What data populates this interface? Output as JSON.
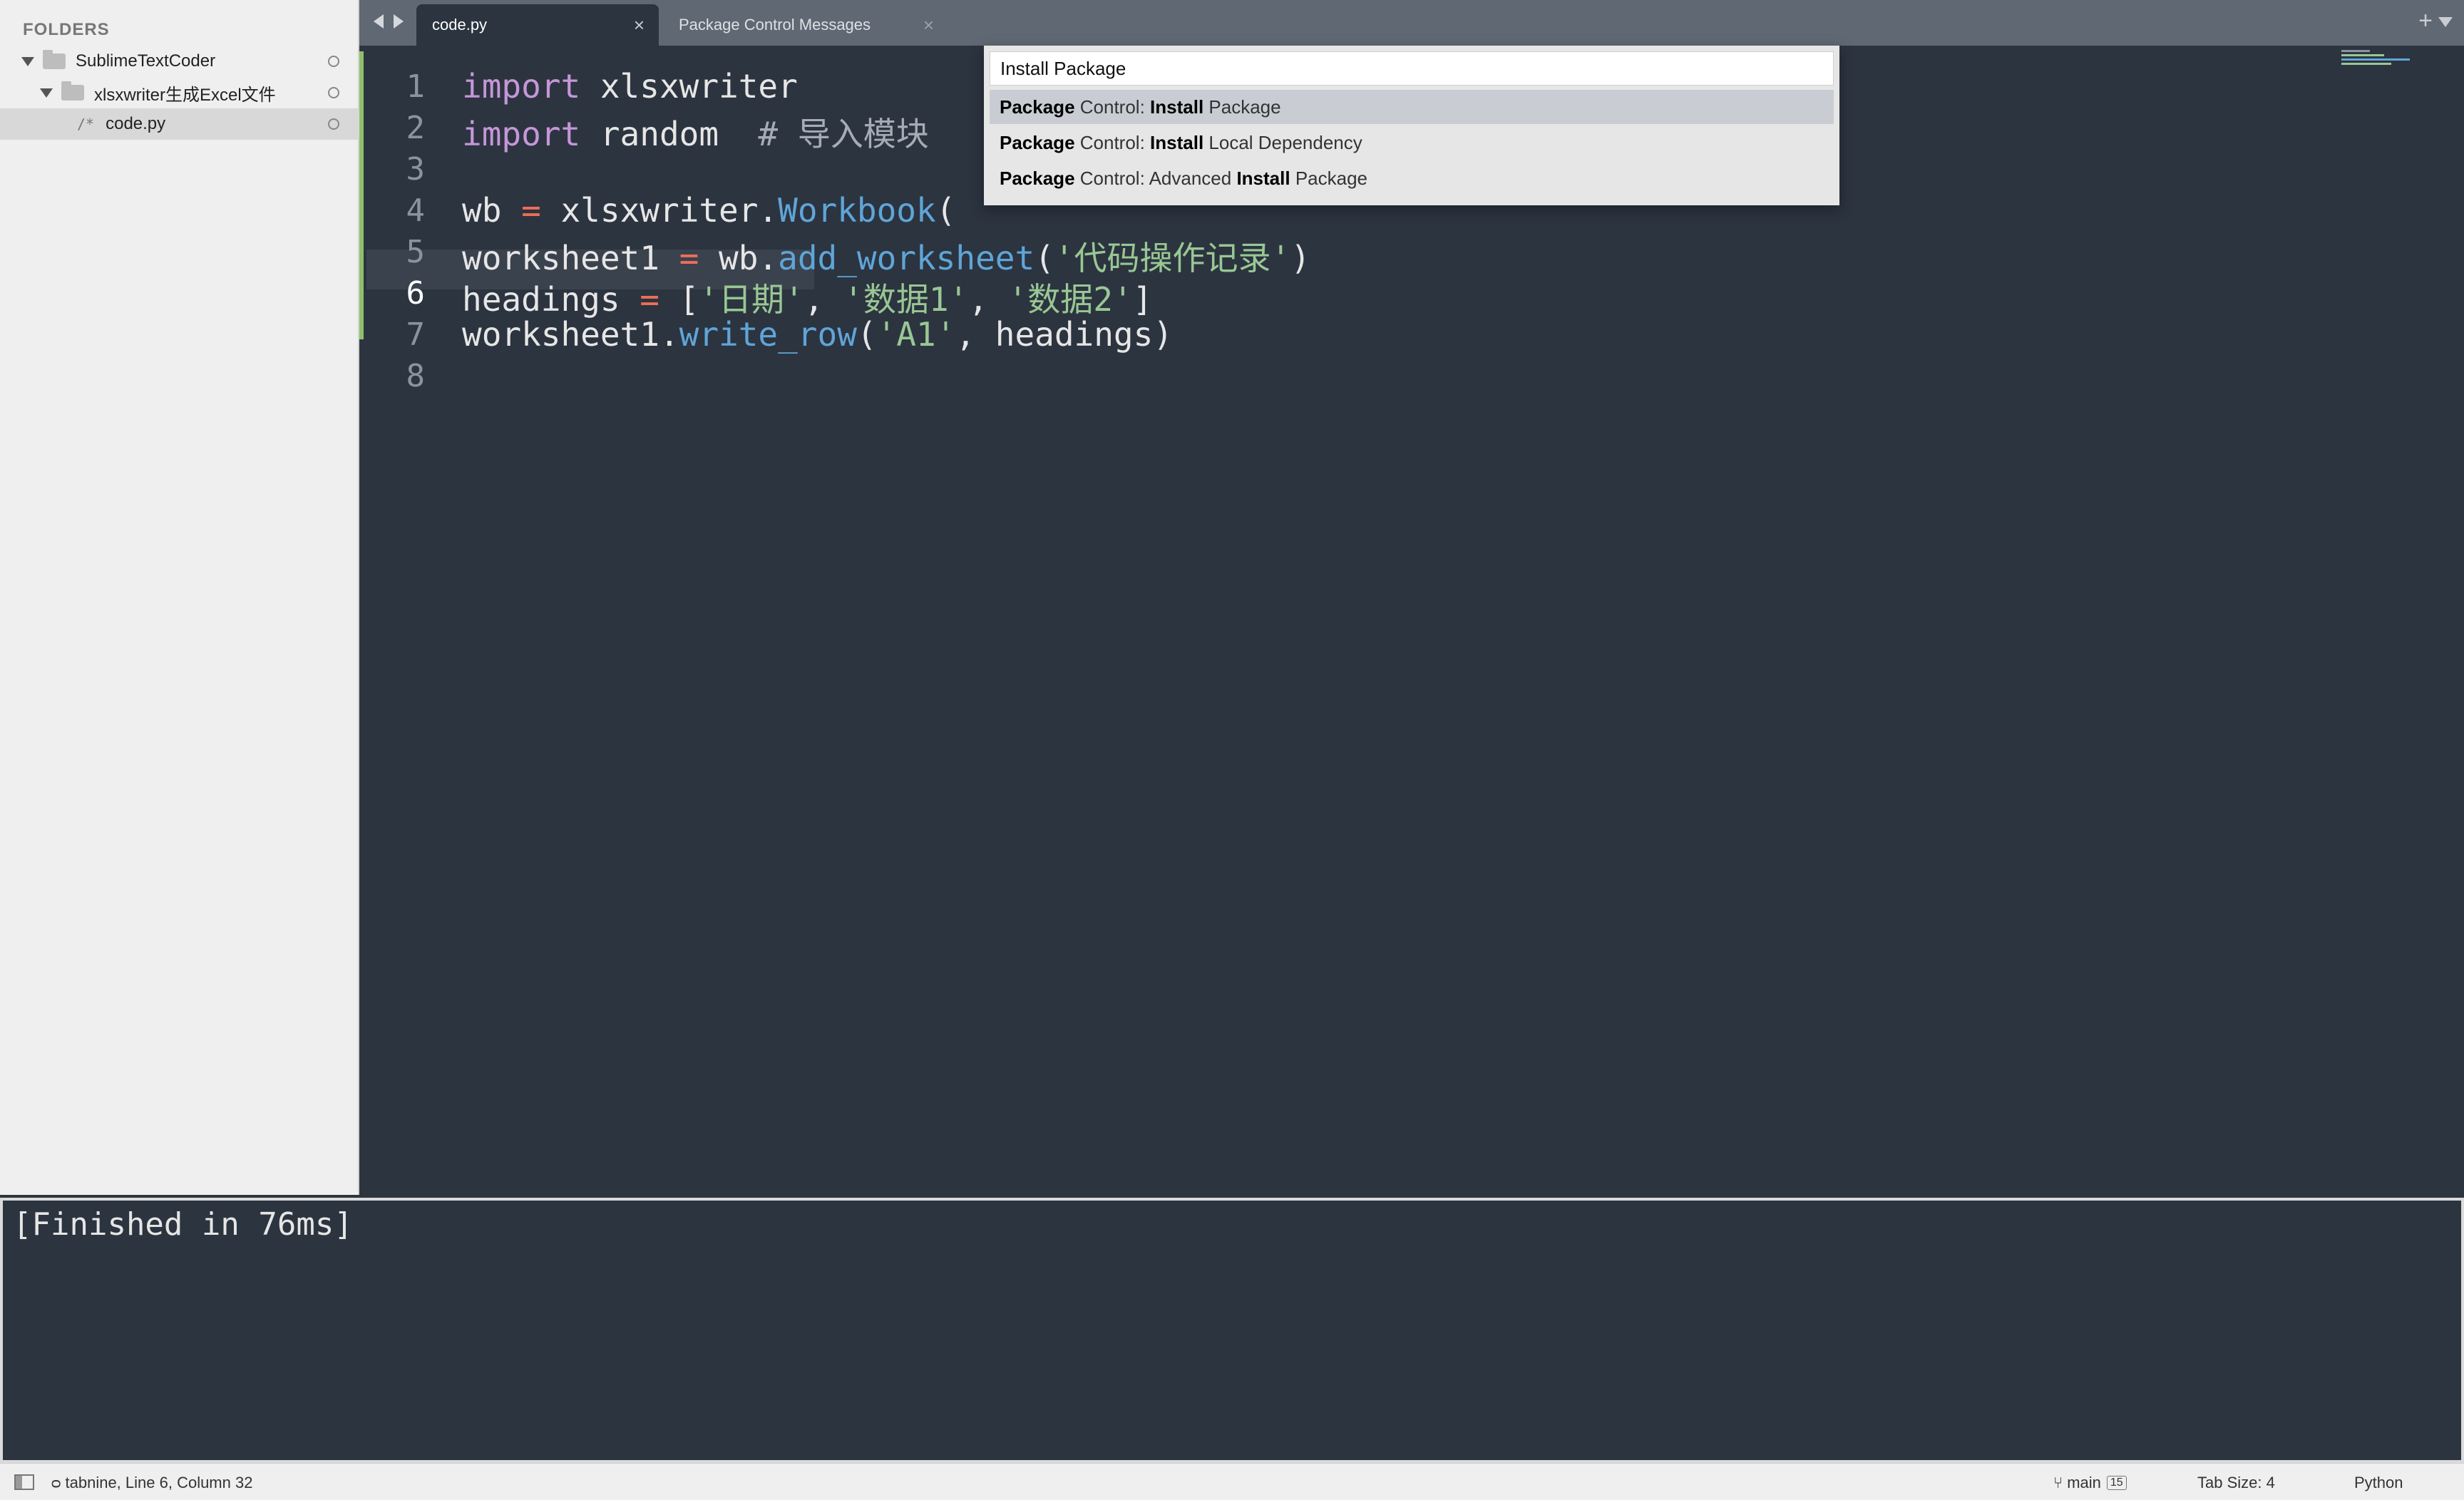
{
  "sidebar": {
    "header": "FOLDERS",
    "items": [
      {
        "label": "SublimeTextCoder",
        "type": "folder"
      },
      {
        "label": "xlsxwriter生成Excel文件",
        "type": "folder"
      },
      {
        "label": "code.py",
        "type": "file",
        "icon": "/*"
      }
    ]
  },
  "tabs": [
    {
      "label": "code.py",
      "close": "×",
      "active": true
    },
    {
      "label": "Package Control Messages",
      "close": "×",
      "active": false
    }
  ],
  "tabbar": {
    "new_tab": "+"
  },
  "editor": {
    "line_numbers": [
      "1",
      "2",
      "3",
      "4",
      "5",
      "6",
      "7",
      "8"
    ],
    "current_line": "6",
    "code": {
      "l1_kw": "import",
      "l1_rest": " xlsxwriter",
      "l2_kw": "import",
      "l2_rest": " random  ",
      "l2_comment": "# 导入模块",
      "l4_a": "wb ",
      "l4_op": "=",
      "l4_b": " xlsxwriter.",
      "l4_fn": "Workbook",
      "l4_c": "(",
      "l5_a": "worksheet1 ",
      "l5_op": "=",
      "l5_b": " wb.",
      "l5_fn": "add_worksheet",
      "l5_c": "(",
      "l5_str": "'代码操作记录'",
      "l5_d": ")",
      "l6_a": "headings ",
      "l6_op": "=",
      "l6_b": " [",
      "l6_s1": "'日期'",
      "l6_sep1": ", ",
      "l6_s2": "'数据1'",
      "l6_sep2": ", ",
      "l6_s3": "'数据2'",
      "l6_c": "]",
      "l7_a": "worksheet1.",
      "l7_fn": "write_row",
      "l7_b": "(",
      "l7_str": "'A1'",
      "l7_c": ", headings)"
    }
  },
  "palette": {
    "input_value": "Install Package",
    "items": [
      {
        "pre_bold": "Package",
        "pre": " Control: ",
        "bold": "Install",
        "post": " Package",
        "selected": true
      },
      {
        "pre_bold": "Package",
        "pre": " Control: ",
        "bold": "Install",
        "post": " Local Dependency",
        "selected": false
      },
      {
        "pre_bold": "Package",
        "pre": " Control: Advanced ",
        "bold": "Install",
        "post": " Package",
        "selected": false
      }
    ]
  },
  "output": {
    "text": "[Finished in 76ms]"
  },
  "statusbar": {
    "left": "ᴑ tabnine, Line 6, Column 32",
    "branch": "main",
    "branch_count": "15",
    "tab_size": "Tab Size: 4",
    "syntax": "Python"
  },
  "colors": {
    "editor_bg": "#2c3440",
    "keyword": "#c696d8",
    "function": "#5fa5d8",
    "operator": "#ee6e57",
    "string": "#99c794",
    "gutter_modified": "#8fc16c"
  }
}
